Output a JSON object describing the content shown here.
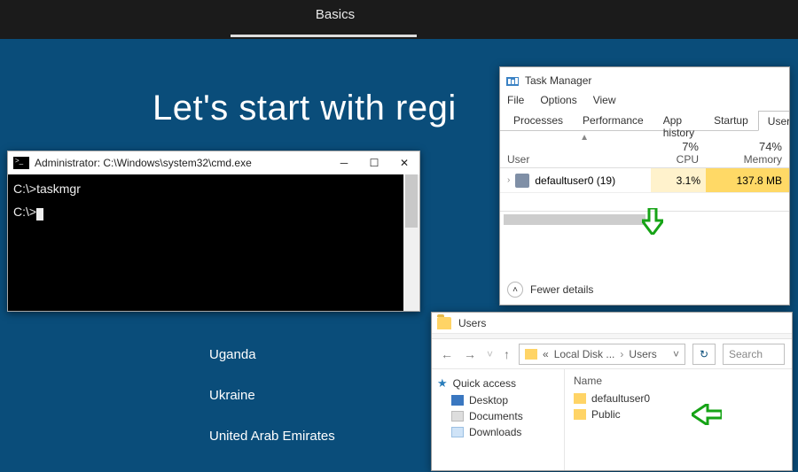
{
  "top": {
    "tab": "Basics"
  },
  "heading": "Let's start with regi",
  "countries": {
    "c0": "Uganda",
    "c1": "Ukraine",
    "c2": "United Arab Emirates"
  },
  "cmd": {
    "title": "Administrator: C:\\Windows\\system32\\cmd.exe",
    "min": "─",
    "max": "☐",
    "close": "✕",
    "line1": "C:\\>taskmgr",
    "line2": "C:\\>"
  },
  "tm": {
    "title": "Task Manager",
    "menu_file": "File",
    "menu_options": "Options",
    "menu_view": "View",
    "tab_processes": "Processes",
    "tab_performance": "Performance",
    "tab_apphist": "App history",
    "tab_startup": "Startup",
    "tab_users": "Users",
    "h_user": "User",
    "h_cpu_label": "CPU",
    "h_cpu_val": "7%",
    "h_mem_label": "Memory",
    "h_mem_val": "74%",
    "row_user": "defaultuser0 (19)",
    "row_cpu": "3.1%",
    "row_mem": "137.8 MB",
    "fewer": "Fewer details"
  },
  "exp": {
    "title": "Users",
    "back": "←",
    "fwd": "→",
    "up": "↑",
    "addr_prefix": "«",
    "addr_disk": "Local Disk ...",
    "addr_users": "Users",
    "addr_sep": "›",
    "addr_dd": "˅",
    "refresh": "↻",
    "search": "Search",
    "quick": "Quick access",
    "side_desktop": "Desktop",
    "side_docs": "Documents",
    "side_dl": "Downloads",
    "col_name": "Name",
    "folder0": "defaultuser0",
    "folder1": "Public"
  }
}
